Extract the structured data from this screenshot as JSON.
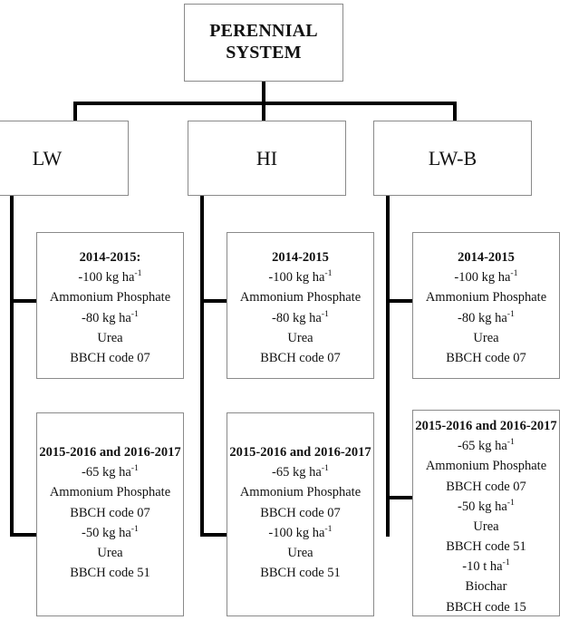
{
  "diagram": {
    "root": {
      "title_line_1": "PERENNIAL",
      "title_line_2": "SYSTEM"
    },
    "groups": [
      {
        "label": "LW"
      },
      {
        "label": "HI"
      },
      {
        "label": "LW-B"
      }
    ],
    "details": [
      {
        "group": "LW",
        "boxes": [
          {
            "heading": "2014-2015:",
            "lines": [
              {
                "text": "-100 kg ha",
                "sup": "-1"
              },
              {
                "text": "Ammonium Phosphate",
                "sup": ""
              },
              {
                "text": "-80 kg ha",
                "sup": "-1"
              },
              {
                "text": "Urea",
                "sup": ""
              },
              {
                "text": "BBCH code 07",
                "sup": ""
              }
            ]
          },
          {
            "heading": "2015-2016 and 2016-2017",
            "lines": [
              {
                "text": "-65 kg ha",
                "sup": "-1"
              },
              {
                "text": "Ammonium Phosphate",
                "sup": ""
              },
              {
                "text": "BBCH code 07",
                "sup": ""
              },
              {
                "text": "-50 kg ha",
                "sup": "-1"
              },
              {
                "text": "Urea",
                "sup": ""
              },
              {
                "text": "BBCH code 51",
                "sup": ""
              }
            ]
          }
        ]
      },
      {
        "group": "HI",
        "boxes": [
          {
            "heading": "2014-2015",
            "lines": [
              {
                "text": "-100 kg ha",
                "sup": "-1"
              },
              {
                "text": "Ammonium Phosphate",
                "sup": ""
              },
              {
                "text": "-80 kg ha",
                "sup": "-1"
              },
              {
                "text": "Urea",
                "sup": ""
              },
              {
                "text": "BBCH code 07",
                "sup": ""
              }
            ]
          },
          {
            "heading": "2015-2016 and 2016-2017",
            "lines": [
              {
                "text": "-65 kg ha",
                "sup": "-1"
              },
              {
                "text": "Ammonium Phosphate",
                "sup": ""
              },
              {
                "text": "BBCH code 07",
                "sup": ""
              },
              {
                "text": "-100 kg ha",
                "sup": "-1"
              },
              {
                "text": "Urea",
                "sup": ""
              },
              {
                "text": "BBCH code 51",
                "sup": ""
              }
            ]
          }
        ]
      },
      {
        "group": "LW-B",
        "boxes": [
          {
            "heading": "2014-2015",
            "lines": [
              {
                "text": "-100 kg ha",
                "sup": "-1"
              },
              {
                "text": "Ammonium Phosphate",
                "sup": ""
              },
              {
                "text": "-80 kg ha",
                "sup": "-1"
              },
              {
                "text": "Urea",
                "sup": ""
              },
              {
                "text": "BBCH code 07",
                "sup": ""
              }
            ]
          },
          {
            "heading": "2015-2016 and 2016-2017",
            "lines": [
              {
                "text": "-65 kg ha",
                "sup": "-1"
              },
              {
                "text": "Ammonium Phosphate",
                "sup": ""
              },
              {
                "text": "BBCH code 07",
                "sup": ""
              },
              {
                "text": "-50 kg ha",
                "sup": "-1"
              },
              {
                "text": "Urea",
                "sup": ""
              },
              {
                "text": "BBCH code 51",
                "sup": ""
              },
              {
                "text": "-10 t ha",
                "sup": "-1"
              },
              {
                "text": "Biochar",
                "sup": ""
              },
              {
                "text": "BBCH code 15",
                "sup": ""
              }
            ]
          }
        ]
      }
    ],
    "colors": {
      "connector": "#000000",
      "box_border": "#8a8a8a",
      "background": "#ffffff",
      "text": "#111111"
    }
  }
}
